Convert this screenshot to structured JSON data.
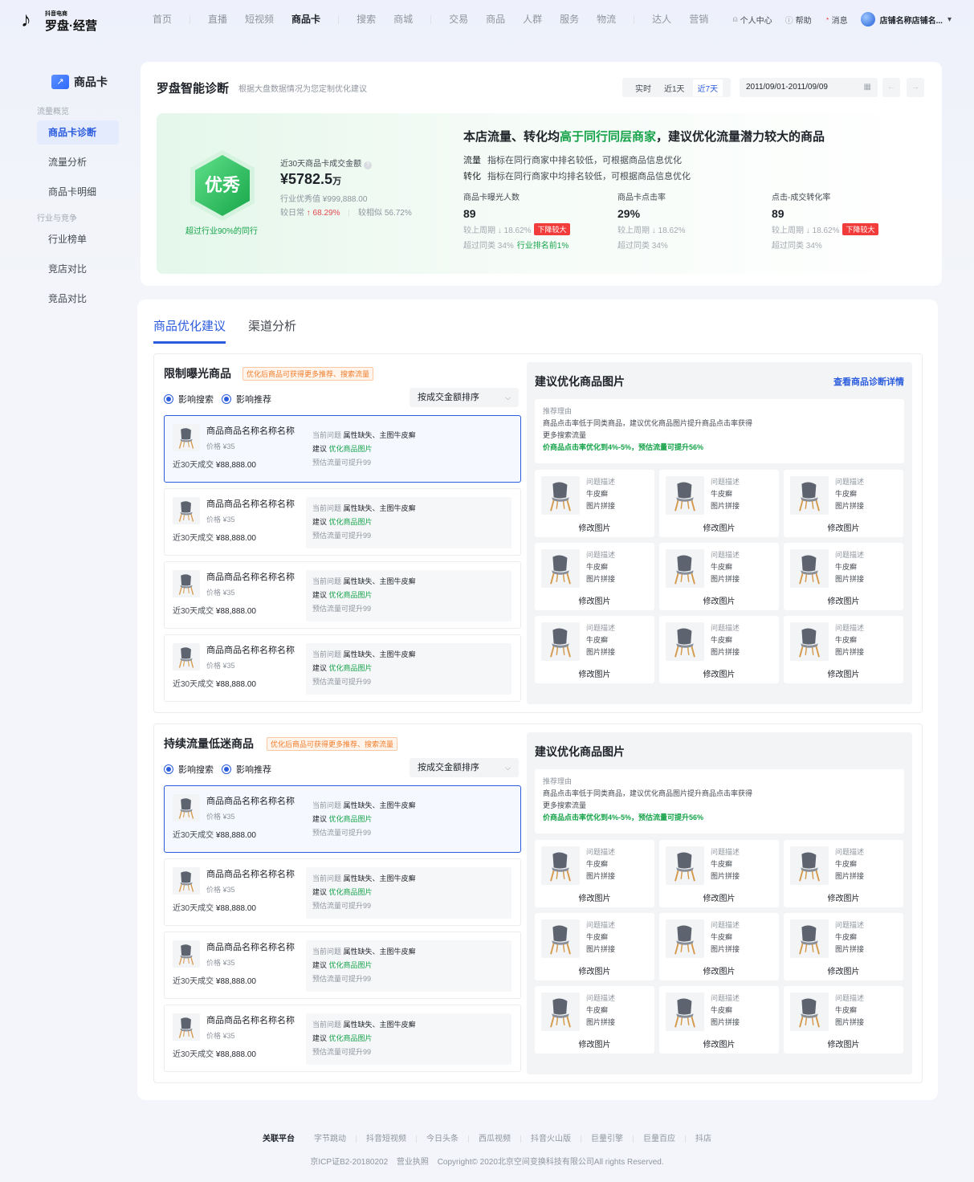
{
  "brand": {
    "small": "抖音电商",
    "big": "罗盘·经营"
  },
  "topnav": [
    {
      "label": "首页",
      "active": false
    },
    {
      "label": "直播",
      "active": false
    },
    {
      "label": "短视频",
      "active": false
    },
    {
      "label": "商品卡",
      "active": true
    },
    {
      "label": "搜索",
      "active": false
    },
    {
      "label": "商城",
      "active": false
    },
    {
      "label": "交易",
      "active": false
    },
    {
      "label": "商品",
      "active": false
    },
    {
      "label": "人群",
      "active": false
    },
    {
      "label": "服务",
      "active": false
    },
    {
      "label": "物流",
      "active": false
    },
    {
      "label": "达人",
      "active": false
    },
    {
      "label": "营销",
      "active": false
    }
  ],
  "user_links": {
    "profile": "个人中心",
    "help": "帮助",
    "messages": "消息",
    "store": "店铺名称店铺名...",
    "chevron": "▾"
  },
  "sidebar": {
    "title": "商品卡",
    "group1": "流量概览",
    "items1": [
      "商品卡诊断",
      "流量分析",
      "商品卡明细"
    ],
    "group2": "行业与竞争",
    "items2": [
      "行业榜单",
      "竞店对比",
      "竞品对比"
    ]
  },
  "diagnosis": {
    "title": "罗盘智能诊断",
    "subtitle": "根据大盘数据情况为您定制优化建议",
    "date_tabs": [
      "实时",
      "近1天",
      "近7天"
    ],
    "date_range": "2011/09/01-2011/09/09",
    "grade": "优秀",
    "beyond": "超过行业90%的同行",
    "gmv_label": "近30天商品卡成交金额",
    "gmv_value": "¥5782.5",
    "gmv_unit": "万",
    "industry_best": "行业优秀值 ¥999,888.00",
    "vs_daily_label": "较日常",
    "vs_daily_value": "↑ 68.29%",
    "vs_similar": "较相似 56.72%",
    "headline_pre": "本店流量、转化均",
    "headline_green": "高于同行同层商家",
    "headline_post": "，建议优化流量潜力较大的商品",
    "line1_k": "流量",
    "line1_v": "指标在同行商家中排名较低，可根据商品信息优化",
    "line2_k": "转化",
    "line2_v": "指标在同行商家中均排名较低，可根据商品信息优化",
    "metrics": [
      {
        "title": "商品卡曝光人数",
        "value": "89",
        "week": "较上周期 ↓ 18.62%",
        "tag": "下降较大",
        "peer": "超过同类 34%",
        "peer_tag": "行业排名前1%"
      },
      {
        "title": "商品卡点击率",
        "value": "29%",
        "week": "较上周期 ↓ 18.62%",
        "tag": "",
        "peer": "超过同类 34%",
        "peer_tag": ""
      },
      {
        "title": "点击-成交转化率",
        "value": "89",
        "week": "较上周期 ↓ 18.62%",
        "tag": "下降较大",
        "peer": "超过同类 34%",
        "peer_tag": ""
      }
    ]
  },
  "tabs": [
    "商品优化建议",
    "渠道分析"
  ],
  "sections": [
    {
      "title": "限制曝光商品",
      "tag": "优化后商品可获得更多推荐、搜索流量",
      "radios": [
        "影响搜索",
        "影响推荐"
      ],
      "sort": "按成交金额排序",
      "products": [
        {
          "name": "商品商品名称名称名称",
          "price": "价格 ¥35",
          "sales_label": "近30天成交",
          "sales": "¥88,888.00",
          "issue_label": "当前问题",
          "issue": "属性缺失、主图牛皮癣",
          "advice_label": "建议",
          "advice": "优化商品图片",
          "estimate": "预估流量可提升99"
        },
        {
          "name": "商品商品名称名称名称",
          "price": "价格 ¥35",
          "sales_label": "近30天成交",
          "sales": "¥88,888.00",
          "issue_label": "当前问题",
          "issue": "属性缺失、主图牛皮癣",
          "advice_label": "建议",
          "advice": "优化商品图片",
          "estimate": "预估流量可提升99"
        },
        {
          "name": "商品商品名称名称名称",
          "price": "价格 ¥35",
          "sales_label": "近30天成交",
          "sales": "¥88,888.00",
          "issue_label": "当前问题",
          "issue": "属性缺失、主图牛皮癣",
          "advice_label": "建议",
          "advice": "优化商品图片",
          "estimate": "预估流量可提升99"
        },
        {
          "name": "商品商品名称名称名称",
          "price": "价格 ¥35",
          "sales_label": "近30天成交",
          "sales": "¥88,888.00",
          "issue_label": "当前问题",
          "issue": "属性缺失、主图牛皮癣",
          "advice_label": "建议",
          "advice": "优化商品图片",
          "estimate": "预估流量可提升99"
        }
      ],
      "panel": {
        "title": "建议优化商品图片",
        "link": "查看商品诊断详情",
        "reason_title": "推荐理由",
        "reason_text1": "商品点击率低于同类商品，建议优化商品图片提升商品点击率获得",
        "reason_text2": "更多搜索流量",
        "reason_green": "价商品点击率优化到4%-5%，预估流量可提升56%",
        "cards": [
          {
            "a": "问题描述",
            "b": "牛皮癣",
            "c": "图片拼接",
            "btn": "修改图片"
          },
          {
            "a": "问题描述",
            "b": "牛皮癣",
            "c": "图片拼接",
            "btn": "修改图片"
          },
          {
            "a": "问题描述",
            "b": "牛皮癣",
            "c": "图片拼接",
            "btn": "修改图片"
          },
          {
            "a": "问题描述",
            "b": "牛皮癣",
            "c": "图片拼接",
            "btn": "修改图片"
          },
          {
            "a": "问题描述",
            "b": "牛皮癣",
            "c": "图片拼接",
            "btn": "修改图片"
          },
          {
            "a": "问题描述",
            "b": "牛皮癣",
            "c": "图片拼接",
            "btn": "修改图片"
          },
          {
            "a": "问题描述",
            "b": "牛皮癣",
            "c": "图片拼接",
            "btn": "修改图片"
          },
          {
            "a": "问题描述",
            "b": "牛皮癣",
            "c": "图片拼接",
            "btn": "修改图片"
          },
          {
            "a": "问题描述",
            "b": "牛皮癣",
            "c": "图片拼接",
            "btn": "修改图片"
          }
        ]
      }
    },
    {
      "title": "持续流量低迷商品",
      "tag": "优化后商品可获得更多推荐、搜索流量",
      "radios": [
        "影响搜索",
        "影响推荐"
      ],
      "sort": "按成交金额排序",
      "products": [
        {
          "name": "商品商品名称名称名称",
          "price": "价格 ¥35",
          "sales_label": "近30天成交",
          "sales": "¥88,888.00",
          "issue_label": "当前问题",
          "issue": "属性缺失、主图牛皮癣",
          "advice_label": "建议",
          "advice": "优化商品图片",
          "estimate": "预估流量可提升99"
        },
        {
          "name": "商品商品名称名称名称",
          "price": "价格 ¥35",
          "sales_label": "近30天成交",
          "sales": "¥88,888.00",
          "issue_label": "当前问题",
          "issue": "属性缺失、主图牛皮癣",
          "advice_label": "建议",
          "advice": "优化商品图片",
          "estimate": "预估流量可提升99"
        },
        {
          "name": "商品商品名称名称名称",
          "price": "价格 ¥35",
          "sales_label": "近30天成交",
          "sales": "¥88,888.00",
          "issue_label": "当前问题",
          "issue": "属性缺失、主图牛皮癣",
          "advice_label": "建议",
          "advice": "优化商品图片",
          "estimate": "预估流量可提升99"
        },
        {
          "name": "商品商品名称名称名称",
          "price": "价格 ¥35",
          "sales_label": "近30天成交",
          "sales": "¥88,888.00",
          "issue_label": "当前问题",
          "issue": "属性缺失、主图牛皮癣",
          "advice_label": "建议",
          "advice": "优化商品图片",
          "estimate": "预估流量可提升99"
        }
      ],
      "panel": {
        "title": "建议优化商品图片",
        "link": "",
        "reason_title": "推荐理由",
        "reason_text1": "商品点击率低于同类商品，建议优化商品图片提升商品点击率获得",
        "reason_text2": "更多搜索流量",
        "reason_green": "价商品点击率优化到4%-5%，预估流量可提升56%",
        "cards": [
          {
            "a": "问题描述",
            "b": "牛皮癣",
            "c": "图片拼接",
            "btn": "修改图片"
          },
          {
            "a": "问题描述",
            "b": "牛皮癣",
            "c": "图片拼接",
            "btn": "修改图片"
          },
          {
            "a": "问题描述",
            "b": "牛皮癣",
            "c": "图片拼接",
            "btn": "修改图片"
          },
          {
            "a": "问题描述",
            "b": "牛皮癣",
            "c": "图片拼接",
            "btn": "修改图片"
          },
          {
            "a": "问题描述",
            "b": "牛皮癣",
            "c": "图片拼接",
            "btn": "修改图片"
          },
          {
            "a": "问题描述",
            "b": "牛皮癣",
            "c": "图片拼接",
            "btn": "修改图片"
          },
          {
            "a": "问题描述",
            "b": "牛皮癣",
            "c": "图片拼接",
            "btn": "修改图片"
          },
          {
            "a": "问题描述",
            "b": "牛皮癣",
            "c": "图片拼接",
            "btn": "修改图片"
          },
          {
            "a": "问题描述",
            "b": "牛皮癣",
            "c": "图片拼接",
            "btn": "修改图片"
          }
        ]
      }
    }
  ],
  "footer": {
    "links": [
      "关联平台",
      "字节跳动",
      "抖音短视频",
      "今日头条",
      "西瓜视频",
      "抖音火山版",
      "巨量引擎",
      "巨量百应",
      "抖店"
    ],
    "icp": "京ICP证B2-20180202",
    "license": "营业执照",
    "copyright": "Copyright© 2020北京空间变换科技有限公司All rights Reserved."
  },
  "colors": {
    "primary": "#2b5cde",
    "green": "#16a34a",
    "red": "#e5484d",
    "orange": "#f07c2a"
  }
}
